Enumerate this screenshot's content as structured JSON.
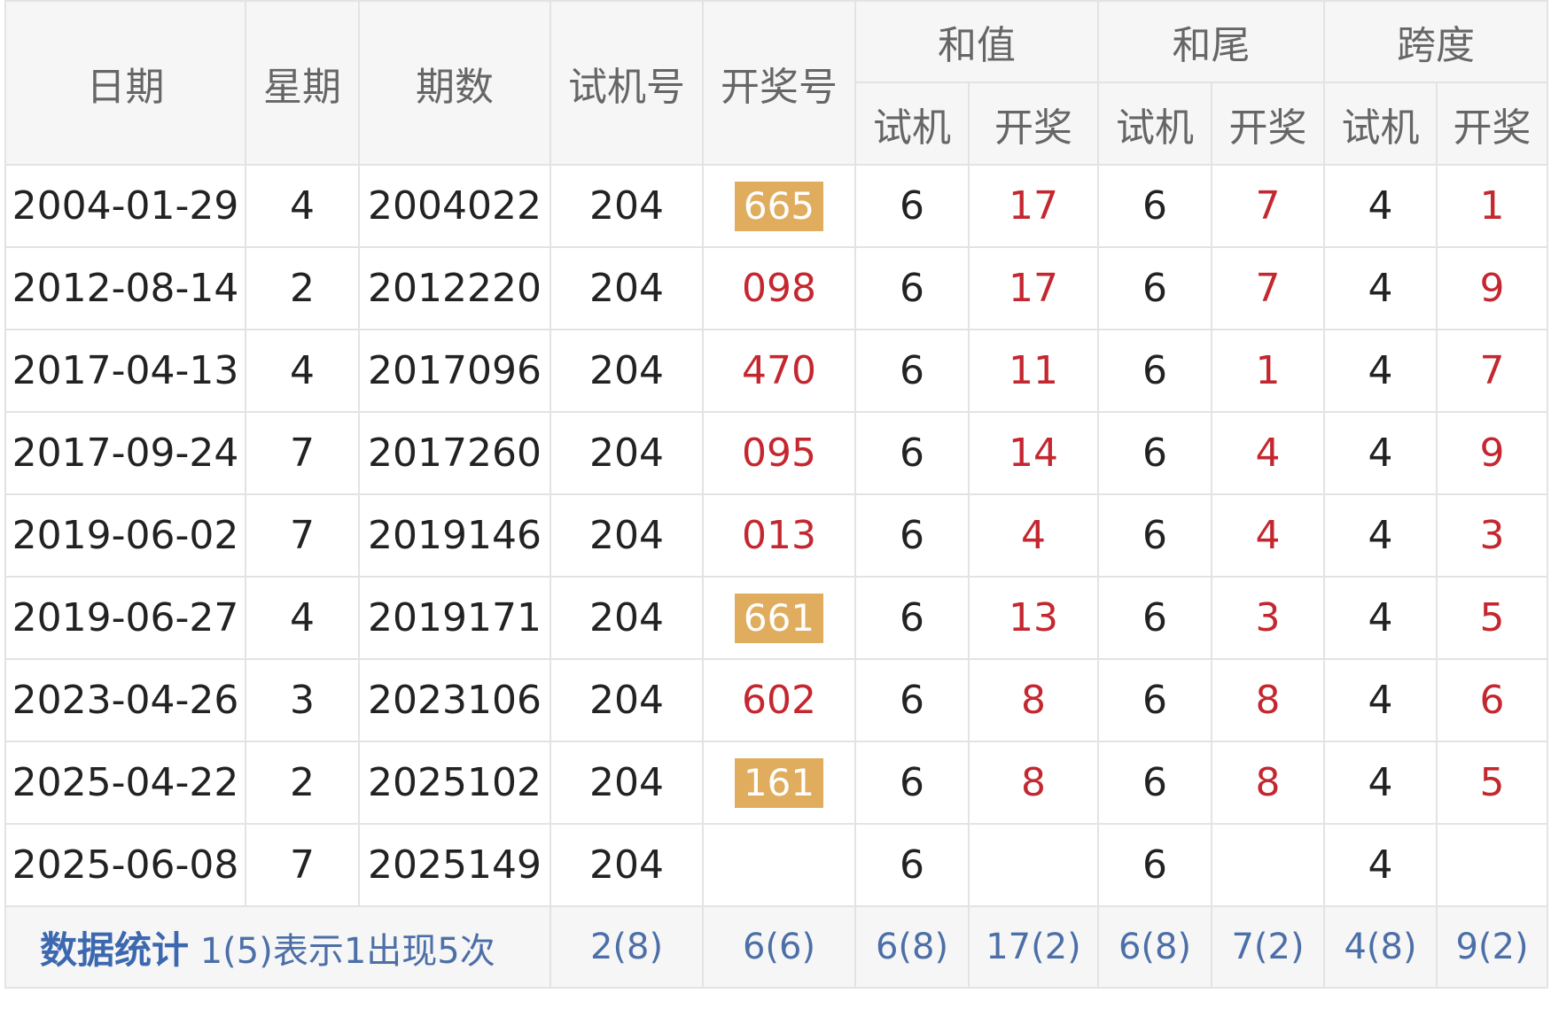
{
  "headers": {
    "date": "日期",
    "weekday": "星期",
    "period": "期数",
    "trial_no": "试机号",
    "draw_no": "开奖号",
    "sum": "和值",
    "sum_tail": "和尾",
    "span": "跨度",
    "sub_trial": "试机",
    "sub_draw": "开奖"
  },
  "rows": [
    {
      "date": "2004-01-29",
      "weekday": "4",
      "period": "2004022",
      "trial": "204",
      "draw": "665",
      "draw_highlight": true,
      "sum_trial": "6",
      "sum_draw": "17",
      "tail_trial": "6",
      "tail_draw": "7",
      "span_trial": "4",
      "span_draw": "1"
    },
    {
      "date": "2012-08-14",
      "weekday": "2",
      "period": "2012220",
      "trial": "204",
      "draw": "098",
      "draw_highlight": false,
      "sum_trial": "6",
      "sum_draw": "17",
      "tail_trial": "6",
      "tail_draw": "7",
      "span_trial": "4",
      "span_draw": "9"
    },
    {
      "date": "2017-04-13",
      "weekday": "4",
      "period": "2017096",
      "trial": "204",
      "draw": "470",
      "draw_highlight": false,
      "sum_trial": "6",
      "sum_draw": "11",
      "tail_trial": "6",
      "tail_draw": "1",
      "span_trial": "4",
      "span_draw": "7"
    },
    {
      "date": "2017-09-24",
      "weekday": "7",
      "period": "2017260",
      "trial": "204",
      "draw": "095",
      "draw_highlight": false,
      "sum_trial": "6",
      "sum_draw": "14",
      "tail_trial": "6",
      "tail_draw": "4",
      "span_trial": "4",
      "span_draw": "9"
    },
    {
      "date": "2019-06-02",
      "weekday": "7",
      "period": "2019146",
      "trial": "204",
      "draw": "013",
      "draw_highlight": false,
      "sum_trial": "6",
      "sum_draw": "4",
      "tail_trial": "6",
      "tail_draw": "4",
      "span_trial": "4",
      "span_draw": "3"
    },
    {
      "date": "2019-06-27",
      "weekday": "4",
      "period": "2019171",
      "trial": "204",
      "draw": "661",
      "draw_highlight": true,
      "sum_trial": "6",
      "sum_draw": "13",
      "tail_trial": "6",
      "tail_draw": "3",
      "span_trial": "4",
      "span_draw": "5"
    },
    {
      "date": "2023-04-26",
      "weekday": "3",
      "period": "2023106",
      "trial": "204",
      "draw": "602",
      "draw_highlight": false,
      "sum_trial": "6",
      "sum_draw": "8",
      "tail_trial": "6",
      "tail_draw": "8",
      "span_trial": "4",
      "span_draw": "6"
    },
    {
      "date": "2025-04-22",
      "weekday": "2",
      "period": "2025102",
      "trial": "204",
      "draw": "161",
      "draw_highlight": true,
      "sum_trial": "6",
      "sum_draw": "8",
      "tail_trial": "6",
      "tail_draw": "8",
      "span_trial": "4",
      "span_draw": "5"
    },
    {
      "date": "2025-06-08",
      "weekday": "7",
      "period": "2025149",
      "trial": "204",
      "draw": "",
      "draw_highlight": false,
      "sum_trial": "6",
      "sum_draw": "",
      "tail_trial": "6",
      "tail_draw": "",
      "span_trial": "4",
      "span_draw": ""
    }
  ],
  "stats": {
    "title": "数据统计",
    "note": "1(5)表示1出现5次",
    "trial": "2(8)",
    "draw": "6(6)",
    "sum_trial": "6(8)",
    "sum_draw": "17(2)",
    "tail_trial": "6(8)",
    "tail_draw": "7(2)",
    "span_trial": "4(8)",
    "span_draw": "9(2)"
  },
  "colors": {
    "highlight_ball": "#e0ad5e",
    "draw_red": "#c4272f",
    "stats_blue": "#3c68b0",
    "header_bg": "#f6f6f6",
    "grid": "#e3e3e3"
  }
}
